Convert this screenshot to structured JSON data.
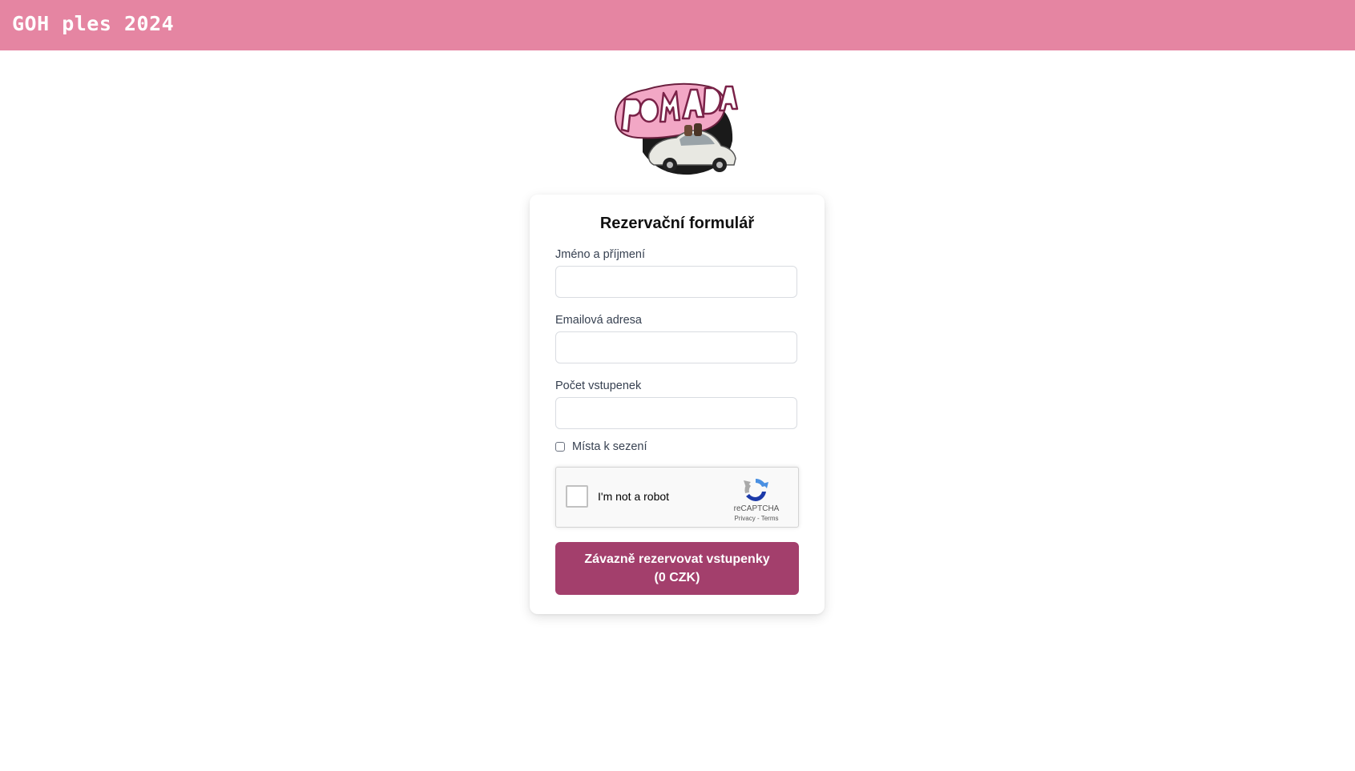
{
  "header": {
    "title": "GOH ples 2024",
    "background_color": "#e585a2"
  },
  "logo": {
    "text": "POMÁDA",
    "icon": "pomada-car-logo"
  },
  "form": {
    "title": "Rezervační formulář",
    "fields": [
      {
        "label": "Jméno a příjmení",
        "value": "",
        "type": "text"
      },
      {
        "label": "Emailová adresa",
        "value": "",
        "type": "email"
      },
      {
        "label": "Počet vstupenek",
        "value": "",
        "type": "number"
      }
    ],
    "seating_checkbox": {
      "label": "Místa k sezení",
      "checked": false
    },
    "captcha": {
      "text": "I'm not a robot",
      "brand": "reCAPTCHA",
      "privacy": "Privacy",
      "separator": " - ",
      "terms": "Terms",
      "checked": false
    },
    "submit": {
      "line1": "Závazně rezervovat vstupenky",
      "line2": "(0 CZK)",
      "color": "#a33f6c"
    }
  }
}
